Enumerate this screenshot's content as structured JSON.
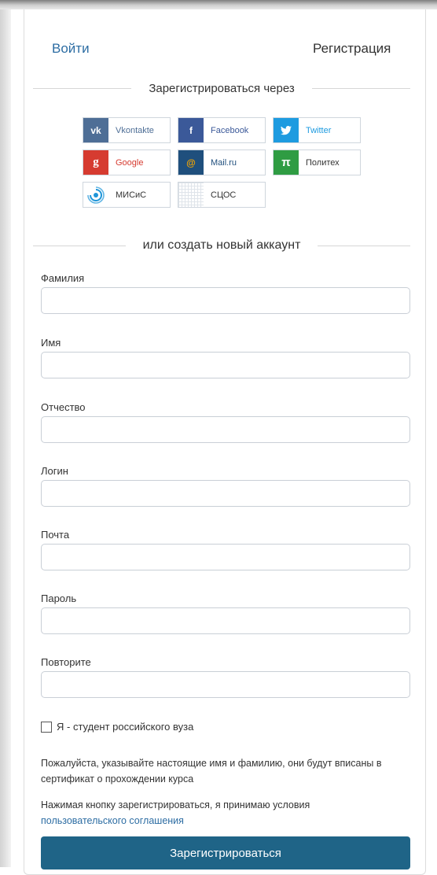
{
  "tabs": {
    "login": "Войти",
    "register": "Регистрация"
  },
  "social_heading": "Зарегистрироваться через",
  "social": [
    {
      "label": "Vkontakte",
      "icon": "vk-icon",
      "glyph": "vk",
      "color": "#4e6e96"
    },
    {
      "label": "Facebook",
      "icon": "facebook-icon",
      "glyph": "f",
      "color": "#3b5999"
    },
    {
      "label": "Twitter",
      "icon": "twitter-icon",
      "glyph": "🐦",
      "color": "#1e9be0"
    },
    {
      "label": "Google",
      "icon": "google-icon",
      "glyph": "g",
      "color": "#d63b30"
    },
    {
      "label": "Mail.ru",
      "icon": "mailru-icon",
      "glyph": "@",
      "color": "#1f4f7d"
    },
    {
      "label": "Политех",
      "icon": "polytech-pi-icon",
      "glyph": "π",
      "color": "#2f9c43"
    },
    {
      "label": "МИСиС",
      "icon": "misis-icon",
      "glyph": "◉",
      "color": "#1e95d8"
    },
    {
      "label": "СЦОС",
      "icon": "scos-grid-icon",
      "glyph": "",
      "color": "#dfe4ea"
    }
  ],
  "new_account_heading": "или создать новый аккаунт",
  "fields": {
    "last_name": {
      "label": "Фамилия",
      "value": ""
    },
    "first_name": {
      "label": "Имя",
      "value": ""
    },
    "patronymic": {
      "label": "Отчество",
      "value": ""
    },
    "login": {
      "label": "Логин",
      "value": ""
    },
    "email": {
      "label": "Почта",
      "value": ""
    },
    "password": {
      "label": "Пароль",
      "value": ""
    },
    "repeat": {
      "label": "Повторите",
      "value": ""
    }
  },
  "student_checkbox": {
    "label": "Я - студент российского вуза",
    "checked": false
  },
  "note1": "Пожалуйста, указывайте настоящие имя и фамилию, они будут вписаны в сертификат о прохождении курса",
  "note2_text": "Нажимая кнопку зарегистрироваться, я принимаю условия",
  "note2_link": "пользовательского соглашения",
  "submit_label": "Зарегистрироваться",
  "colors": {
    "accent": "#1f6487",
    "link": "#2d6da3"
  }
}
